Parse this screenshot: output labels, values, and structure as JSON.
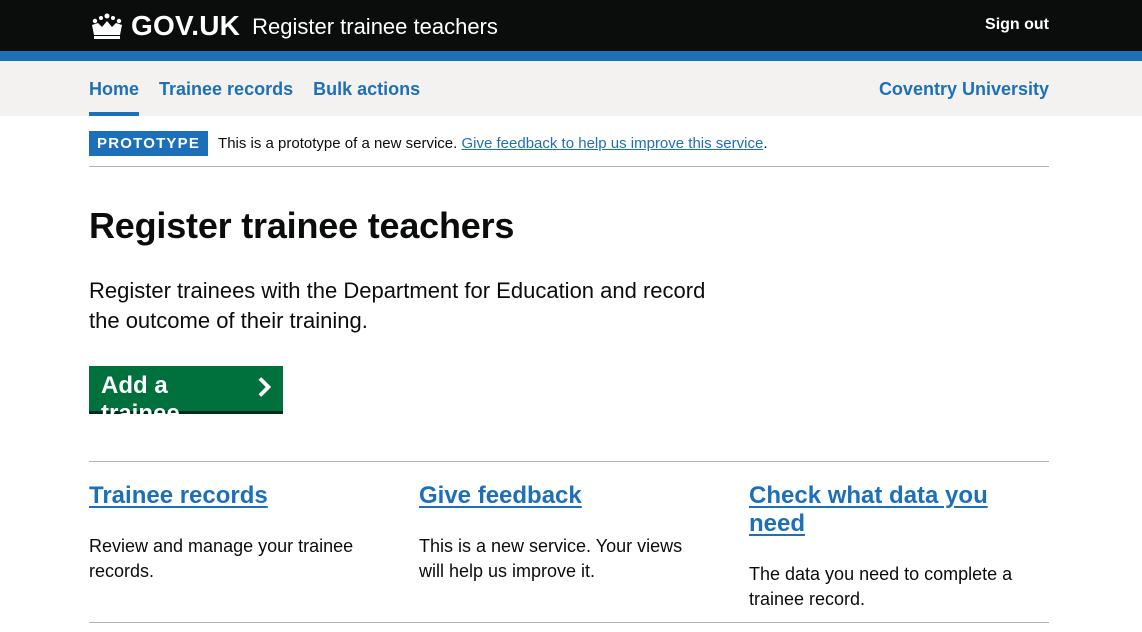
{
  "header": {
    "brand": "GOV.UK",
    "service_name": "Register trainee teachers",
    "sign_out": "Sign out"
  },
  "nav": {
    "items": [
      {
        "label": "Home",
        "active": true
      },
      {
        "label": "Trainee records",
        "active": false
      },
      {
        "label": "Bulk actions",
        "active": false
      }
    ],
    "organisation": "Coventry University"
  },
  "banner": {
    "tag": "PROTOTYPE",
    "text": "This is a prototype of a new service.",
    "link": "Give feedback to help us improve this service",
    "end": "."
  },
  "main": {
    "title": "Register trainee teachers",
    "lead": "Register trainees with the Department for Education and record the outcome of their training.",
    "start_button": "Add a trainee"
  },
  "cards": [
    {
      "title": "Trainee records",
      "description": "Review and manage your trainee records."
    },
    {
      "title": "Give feedback",
      "description": "This is a new service. Your views will help us improve it."
    },
    {
      "title": "Check what data you need",
      "description": "The data you need to complete a trainee record."
    }
  ],
  "colors": {
    "header_bg": "#0b0c0c",
    "brand_blue": "#1d70b8",
    "start_green": "#00703c",
    "nav_bg": "#f3f2f1"
  },
  "icons": [
    "crown-icon",
    "chevron-right-icon"
  ]
}
